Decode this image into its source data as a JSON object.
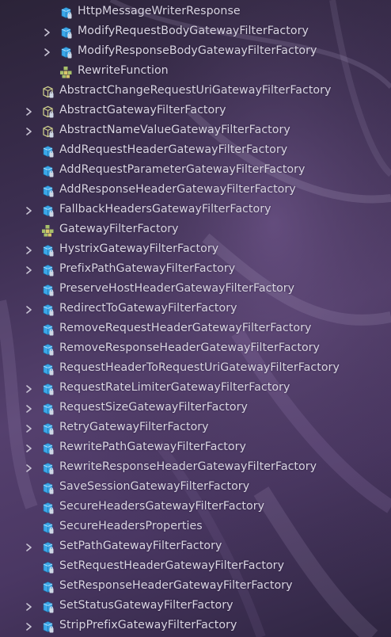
{
  "tree": {
    "items": [
      {
        "label": "HttpMessageWriterResponse",
        "depth": 2,
        "expandable": false,
        "icon": "class-icon"
      },
      {
        "label": "ModifyRequestBodyGatewayFilterFactory",
        "depth": 2,
        "expandable": true,
        "icon": "class-icon"
      },
      {
        "label": "ModifyResponseBodyGatewayFilterFactory",
        "depth": 2,
        "expandable": true,
        "icon": "class-icon"
      },
      {
        "label": "RewriteFunction",
        "depth": 2,
        "expandable": false,
        "icon": "interface-icon"
      },
      {
        "label": "AbstractChangeRequestUriGatewayFilterFactory",
        "depth": 1,
        "expandable": false,
        "icon": "abstract-class-icon"
      },
      {
        "label": "AbstractGatewayFilterFactory",
        "depth": 1,
        "expandable": true,
        "icon": "abstract-class-icon"
      },
      {
        "label": "AbstractNameValueGatewayFilterFactory",
        "depth": 1,
        "expandable": true,
        "icon": "abstract-class-icon"
      },
      {
        "label": "AddRequestHeaderGatewayFilterFactory",
        "depth": 1,
        "expandable": false,
        "icon": "class-icon"
      },
      {
        "label": "AddRequestParameterGatewayFilterFactory",
        "depth": 1,
        "expandable": false,
        "icon": "class-icon"
      },
      {
        "label": "AddResponseHeaderGatewayFilterFactory",
        "depth": 1,
        "expandable": false,
        "icon": "class-icon"
      },
      {
        "label": "FallbackHeadersGatewayFilterFactory",
        "depth": 1,
        "expandable": true,
        "icon": "class-icon"
      },
      {
        "label": "GatewayFilterFactory",
        "depth": 1,
        "expandable": false,
        "icon": "interface-icon"
      },
      {
        "label": "HystrixGatewayFilterFactory",
        "depth": 1,
        "expandable": true,
        "icon": "class-icon"
      },
      {
        "label": "PrefixPathGatewayFilterFactory",
        "depth": 1,
        "expandable": true,
        "icon": "class-icon"
      },
      {
        "label": "PreserveHostHeaderGatewayFilterFactory",
        "depth": 1,
        "expandable": false,
        "icon": "class-icon"
      },
      {
        "label": "RedirectToGatewayFilterFactory",
        "depth": 1,
        "expandable": true,
        "icon": "class-icon"
      },
      {
        "label": "RemoveRequestHeaderGatewayFilterFactory",
        "depth": 1,
        "expandable": false,
        "icon": "class-icon"
      },
      {
        "label": "RemoveResponseHeaderGatewayFilterFactory",
        "depth": 1,
        "expandable": false,
        "icon": "class-icon"
      },
      {
        "label": "RequestHeaderToRequestUriGatewayFilterFactory",
        "depth": 1,
        "expandable": false,
        "icon": "class-icon"
      },
      {
        "label": "RequestRateLimiterGatewayFilterFactory",
        "depth": 1,
        "expandable": true,
        "icon": "class-icon"
      },
      {
        "label": "RequestSizeGatewayFilterFactory",
        "depth": 1,
        "expandable": true,
        "icon": "class-icon"
      },
      {
        "label": "RetryGatewayFilterFactory",
        "depth": 1,
        "expandable": true,
        "icon": "class-icon"
      },
      {
        "label": "RewritePathGatewayFilterFactory",
        "depth": 1,
        "expandable": true,
        "icon": "class-icon"
      },
      {
        "label": "RewriteResponseHeaderGatewayFilterFactory",
        "depth": 1,
        "expandable": true,
        "icon": "class-icon"
      },
      {
        "label": "SaveSessionGatewayFilterFactory",
        "depth": 1,
        "expandable": false,
        "icon": "class-icon"
      },
      {
        "label": "SecureHeadersGatewayFilterFactory",
        "depth": 1,
        "expandable": false,
        "icon": "class-icon"
      },
      {
        "label": "SecureHeadersProperties",
        "depth": 1,
        "expandable": false,
        "icon": "class-icon"
      },
      {
        "label": "SetPathGatewayFilterFactory",
        "depth": 1,
        "expandable": true,
        "icon": "class-icon"
      },
      {
        "label": "SetRequestHeaderGatewayFilterFactory",
        "depth": 1,
        "expandable": false,
        "icon": "class-icon"
      },
      {
        "label": "SetResponseHeaderGatewayFilterFactory",
        "depth": 1,
        "expandable": false,
        "icon": "class-icon"
      },
      {
        "label": "SetStatusGatewayFilterFactory",
        "depth": 1,
        "expandable": true,
        "icon": "class-icon"
      },
      {
        "label": "StripPrefixGatewayFilterFactory",
        "depth": 1,
        "expandable": true,
        "icon": "class-icon"
      }
    ]
  },
  "colors": {
    "text": "#d9d5e2",
    "chevron": "#c9c4d4",
    "class_icon": "#3aa7e8",
    "abstract_icon": "#c9c98a",
    "interface_icon": "#a8c06a"
  }
}
